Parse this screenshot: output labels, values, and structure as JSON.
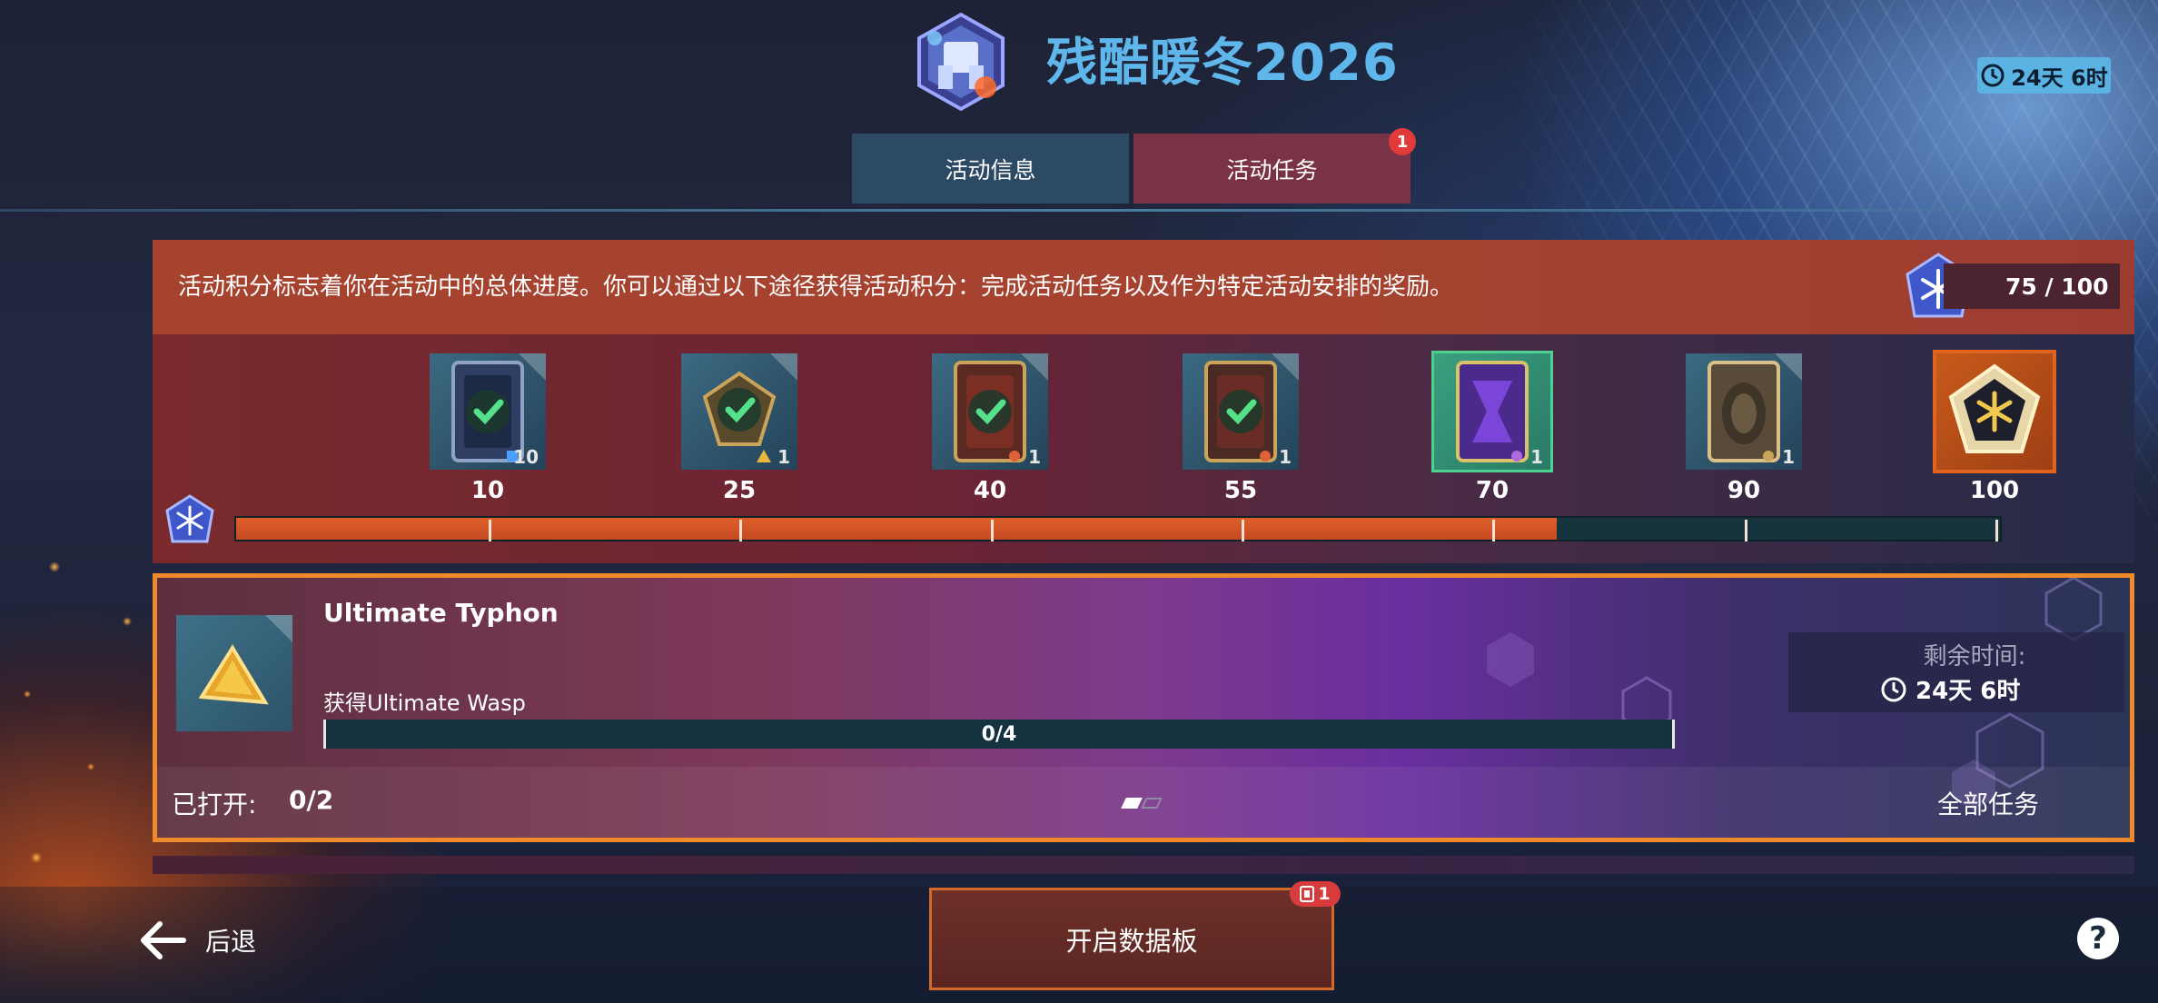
{
  "header": {
    "title": "残酷暖冬2026",
    "timer": "24天 6时",
    "emblem_icon": "snow-mech-emblem-icon"
  },
  "tabs": [
    {
      "label": "活动信息",
      "active": false
    },
    {
      "label": "活动任务",
      "active": true,
      "badge": "1"
    }
  ],
  "progress": {
    "description": "活动积分标志着你在活动中的总体进度。你可以通过以下途径获得活动积分：完成活动任务以及作为特定活动安排的奖励。",
    "score": "75 / 100",
    "current": 75,
    "max": 100,
    "milestones": [
      {
        "points": "10",
        "qty": "10",
        "claimed": true
      },
      {
        "points": "25",
        "qty": "1",
        "claimed": true
      },
      {
        "points": "40",
        "qty": "1",
        "claimed": true
      },
      {
        "points": "55",
        "qty": "1",
        "claimed": true
      },
      {
        "points": "70",
        "qty": "1",
        "claimed": false
      },
      {
        "points": "90",
        "qty": "1",
        "claimed": false
      },
      {
        "points": "100",
        "qty": "",
        "claimed": false
      }
    ]
  },
  "task": {
    "title": "Ultimate Typhon",
    "description": "获得Ultimate Wasp",
    "progress_label": "0/4",
    "progress": 0,
    "remaining_label": "剩余时间:",
    "remaining_value": "24天 6时",
    "opened_label": "已打开:",
    "opened_value": "0/2",
    "page": 1,
    "pages": 2,
    "all_tasks_label": "全部任务"
  },
  "bottom": {
    "back_label": "后退",
    "datapad_label": "开启数据板",
    "datapad_badge": "1"
  },
  "colors": {
    "title": "#5fb6ea",
    "accent_orange": "#ef8a2c",
    "progress_fill": "#c44a22",
    "check": "#55e08a"
  }
}
